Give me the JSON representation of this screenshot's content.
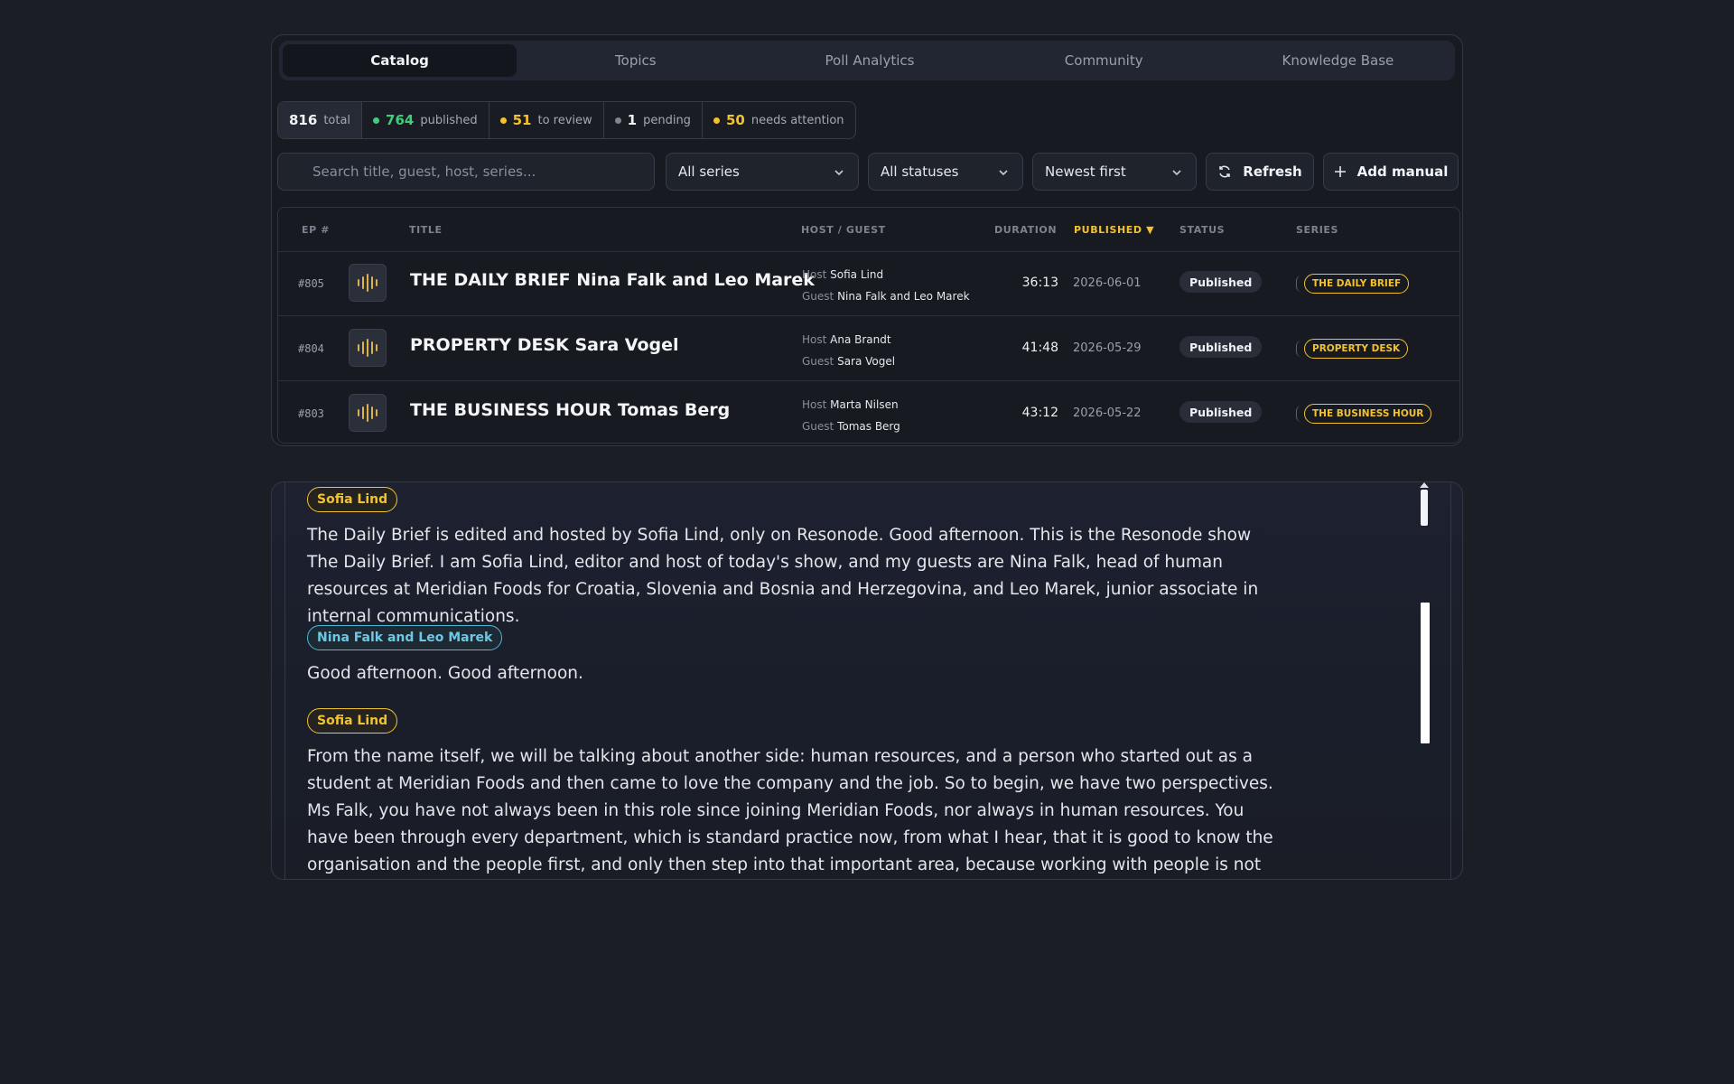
{
  "tabs": [
    {
      "label": "Catalog",
      "active": true
    },
    {
      "label": "Topics",
      "active": false
    },
    {
      "label": "Poll Analytics",
      "active": false
    },
    {
      "label": "Community",
      "active": false
    },
    {
      "label": "Knowledge Base",
      "active": false
    }
  ],
  "stats": {
    "total": {
      "value": "816",
      "label": "total"
    },
    "published": {
      "value": "764",
      "label": "published"
    },
    "review": {
      "value": "51",
      "label": "to review"
    },
    "pending": {
      "value": "1",
      "label": "pending"
    },
    "attention": {
      "value": "50",
      "label": "needs attention"
    }
  },
  "filters": {
    "search_placeholder": "Search title, guest, host, series...",
    "series": "All series",
    "status": "All statuses",
    "sort": "Newest first",
    "refresh": "Refresh",
    "add_manual": "Add manual"
  },
  "table": {
    "headers": {
      "ep": "EP #",
      "title": "TITLE",
      "host_guest": "HOST / GUEST",
      "duration": "DURATION",
      "published": "PUBLISHED ▼",
      "status": "STATUS",
      "series": "SERIES"
    },
    "host_label": "Host",
    "guest_label": "Guest",
    "rows": [
      {
        "ep": "#805",
        "title": "THE DAILY BRIEF Nina Falk and Leo Marek",
        "host": "Sofia Lind",
        "guest": "Nina Falk and Leo Marek",
        "duration": "36:13",
        "published": "2026-06-01",
        "status": "Published",
        "series": "THE DAILY BRIEF"
      },
      {
        "ep": "#804",
        "title": "PROPERTY DESK Sara Vogel",
        "host": "Ana Brandt",
        "guest": "Sara Vogel",
        "duration": "41:48",
        "published": "2026-05-29",
        "status": "Published",
        "series": "PROPERTY DESK"
      },
      {
        "ep": "#803",
        "title": "THE BUSINESS HOUR Tomas Berg",
        "host": "Marta Nilsen",
        "guest": "Tomas Berg",
        "duration": "43:12",
        "published": "2026-05-22",
        "status": "Published",
        "series": "THE BUSINESS HOUR"
      }
    ]
  },
  "transcript": [
    {
      "speaker": "Sofia Lind",
      "role": "host",
      "text": "The Daily Brief is edited and hosted by Sofia Lind, only on Resonode. Good afternoon. This is the Resonode show The Daily Brief. I am Sofia Lind, editor and host of today's show, and my guests are Nina Falk, head of human resources at Meridian Foods for Croatia, Slovenia and Bosnia and Herzegovina, and Leo Marek, junior associate in internal communications."
    },
    {
      "speaker": "Nina Falk and Leo Marek",
      "role": "guest",
      "text": "Good afternoon. Good afternoon."
    },
    {
      "speaker": "Sofia Lind",
      "role": "host",
      "text": "From the name itself, we will be talking about another side: human resources, and a person who started out as a student at Meridian Foods and then came to love the company and the job. So to begin, we have two perspectives. Ms Falk, you have not always been in this role since joining Meridian Foods, nor always in human resources. You have been through every department, which is standard practice now, from what I hear, that it is good to know the organisation and the people first, and only then step into that important area, because working with people is not simple."
    }
  ],
  "colors": {
    "accent": "#f2c230",
    "published_green": "#3ecf7a",
    "guest_blue": "#4fb8d6"
  }
}
